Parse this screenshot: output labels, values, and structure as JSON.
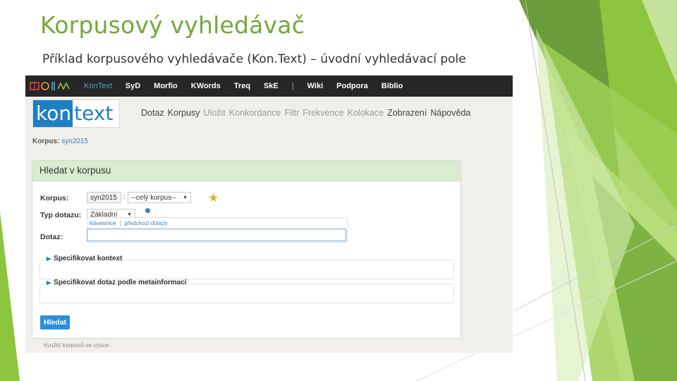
{
  "slide": {
    "title": "Korpusový vyhledávač",
    "subtitle": "Příklad korpusového vyhledávače (Kon.Text) – úvodní vyhledávací pole"
  },
  "topbar": {
    "items": [
      "KonText",
      "SyD",
      "Morfio",
      "KWords",
      "Treq",
      "SkE",
      "|",
      "Wiki",
      "Podpora",
      "Biblio"
    ],
    "active": "KonText"
  },
  "logo": {
    "part1": "kon",
    "part2": "text"
  },
  "mainnav": {
    "items": [
      {
        "label": "Dotaz",
        "enabled": true
      },
      {
        "label": "Korpusy",
        "enabled": true
      },
      {
        "label": "Uložit",
        "enabled": false
      },
      {
        "label": "Konkordance",
        "enabled": false
      },
      {
        "label": "Filtr",
        "enabled": false
      },
      {
        "label": "Frekvence",
        "enabled": false
      },
      {
        "label": "Kolokace",
        "enabled": false
      },
      {
        "label": "Zobrazení",
        "enabled": true
      },
      {
        "label": "Nápověda",
        "enabled": true
      }
    ]
  },
  "corpus_line": {
    "label": "Korpus:",
    "value": "syn2015"
  },
  "panel": {
    "title": "Hledat v korpusu",
    "corpus_label": "Korpus:",
    "corpus_value": "syn2015",
    "subcorpus_value": "--celý korpus--",
    "query_type_label": "Typ dotazu:",
    "query_type_value": "Základní",
    "query_label": "Dotaz:",
    "hint_keyboard": "klávesnice",
    "hint_history": "předchozí dotazy",
    "query_value": "",
    "context_label": "Specifikovat kontext",
    "meta_label": "Specifikovat dotaz podle metainformací",
    "search_button": "Hledat"
  },
  "footer": {
    "text": "Využití korpusů ve výuce"
  },
  "colors": {
    "title_green": "#74a83a",
    "accent_blue": "#1f7fc5",
    "topbar_bg": "#262626"
  }
}
